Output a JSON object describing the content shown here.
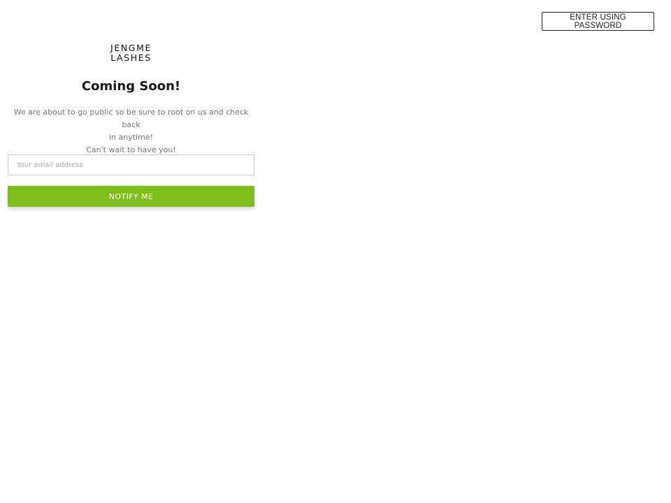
{
  "header": {
    "enter_password_label": "ENTER USING PASSWORD"
  },
  "brand": {
    "logo_line1": "JENGME",
    "logo_line2": "LASHES"
  },
  "main": {
    "title": "Coming Soon!",
    "description_line1": "We are about to go public so be sure to root on us and check back",
    "description_line2": "in anytime!",
    "description_line3": "Can't wait to have you!"
  },
  "signup": {
    "email_placeholder": "Your email address",
    "email_value": "",
    "notify_label": "NOTIFY ME"
  },
  "colors": {
    "accent": "#7fbf1b",
    "text_dark": "#1a1a1a",
    "text_muted": "#777777",
    "border": "#cfcfcf"
  }
}
